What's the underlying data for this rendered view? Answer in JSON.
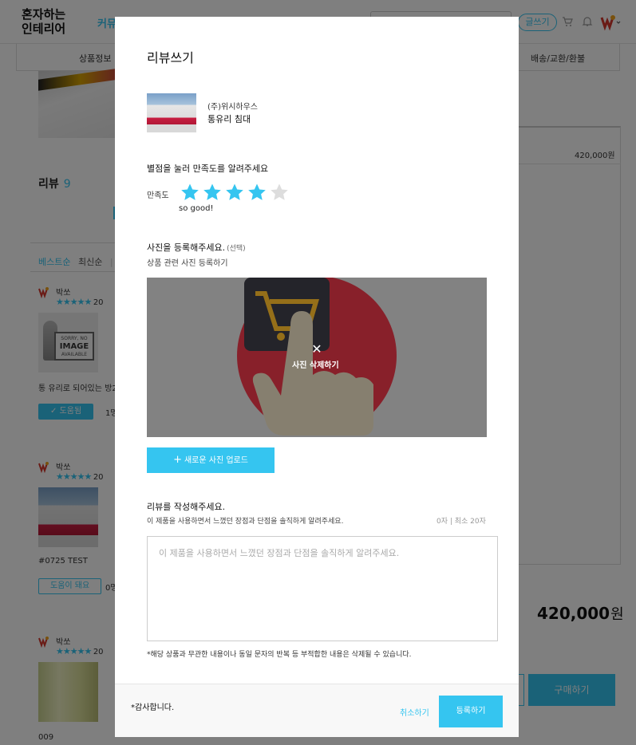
{
  "header": {
    "logo_line1": "혼자하는",
    "logo_line2": "인테리어",
    "nav_partial": "커뮤",
    "write_button": "글쓰기"
  },
  "subnav": {
    "product_info": "상품정보",
    "shipping": "배송/교환/환불"
  },
  "reviews": {
    "heading": "리뷰",
    "count": "9",
    "sort_best": "베스트순",
    "sort_recent": "최신순",
    "sort_sep": "|",
    "items": [
      {
        "user": "박쏘",
        "stars": "★★★★★",
        "date_partial": "20",
        "text": "통 유리로 되어있는 방2",
        "help_label": "✓ 도움됨",
        "help_count": "1명"
      },
      {
        "user": "박쏘",
        "stars": "★★★★★",
        "date_partial": "20",
        "text": "#0725 TEST",
        "help_label": "도움이 돼요",
        "help_count": "0명"
      },
      {
        "user": "박쏘",
        "stars": "★★★★★",
        "date_partial": "20",
        "text": "009"
      }
    ],
    "noimage_line1": "SORRY, NO",
    "noimage_line2": "IMAGE",
    "noimage_line3": "AVAILABLE"
  },
  "sidebar": {
    "price_small": "420,000원",
    "price_big": "420,000",
    "price_big_unit": "원",
    "buy_button": "구매하기"
  },
  "modal": {
    "title": "리뷰쓰기",
    "product_brand": "(주)위시하우스",
    "product_name": "통유리 침대",
    "rating_title": "별점을 눌러 만족도를 알려주세요",
    "rating_label": "만족도",
    "rating_value": 4,
    "rating_max": 5,
    "rating_text": "so good!",
    "photo_title": "사진을 등록해주세요.",
    "photo_optional": "(선택)",
    "photo_subtitle": "상품 관련 사진 등록하기",
    "photo_close": "✕",
    "photo_delete": "사진 삭제하기",
    "upload_plus": "+",
    "upload_button": "새로운 사진 업로드",
    "write_title": "리뷰를 작성해주세요.",
    "write_subtitle": "이 제품을 사용하면서 느꼈던 장점과 단점을 솔직하게 알려주세요.",
    "write_count": "0자 | 최소 20자",
    "textarea_placeholder": "이 제품을 사용하면서 느꼈던 장점과 단점을 솔직하게 알려주세요.",
    "notice": "*해당 상품과 무관한 내용이나 동일 문자의 반복 등 부적합한 내용은 삭제될 수 있습니다.",
    "thanks": "*감사합니다.",
    "cancel_button": "취소하기",
    "submit_button": "등록하기"
  },
  "colors": {
    "accent": "#35c5f0",
    "star_empty": "#dddddd",
    "overlay": "rgba(0,0,0,0.5)"
  }
}
